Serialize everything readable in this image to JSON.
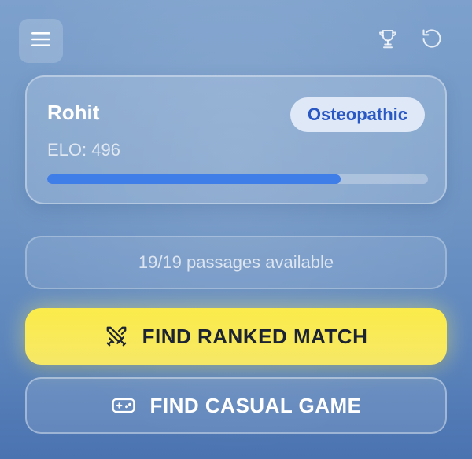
{
  "header": {
    "menu_icon": "hamburger-menu-icon",
    "trophy_icon": "trophy-icon",
    "reset_icon": "rotate-ccw-icon"
  },
  "profile": {
    "name": "Rohit",
    "specialty": "Osteopathic",
    "elo_text": "ELO: 496",
    "elo_progress_percent": 77
  },
  "passages": {
    "status_text": "19/19 passages available"
  },
  "actions": {
    "ranked_label": "FIND RANKED MATCH",
    "ranked_icon": "crossed-swords-icon",
    "casual_label": "FIND CASUAL GAME",
    "casual_icon": "gamepad-icon"
  },
  "colors": {
    "accent_blue": "#3f7de8",
    "badge_text": "#2957c4",
    "ranked_yellow": "#fbeb4a"
  }
}
